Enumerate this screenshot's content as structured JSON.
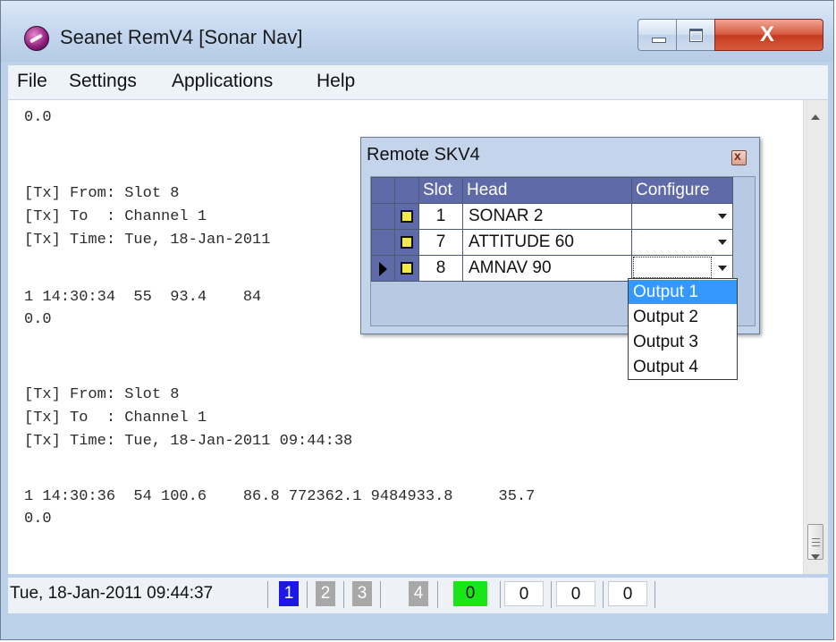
{
  "window": {
    "title": "Seanet RemV4 [Sonar Nav]",
    "minimize_label": "minimize",
    "maximize_label": "maximize",
    "close_label": "X"
  },
  "menu": {
    "items": [
      "File",
      "Settings",
      "Applications",
      "Help"
    ]
  },
  "console": {
    "lines": [
      "0.0",
      "[Tx] From: Slot 8",
      "[Tx] To  : Channel 1",
      "[Tx] Time: Tue, 18-Jan-2011",
      "1 14:30:34  55  93.4    84",
      "0.0",
      "[Tx] From: Slot 8",
      "[Tx] To  : Channel 1",
      "[Tx] Time: Tue, 18-Jan-2011 09:44:38",
      "1 14:30:36  54 100.6    86.8 772362.1 9484933.8     35.7",
      "0.0"
    ]
  },
  "dialog": {
    "title": "Remote SKV4",
    "close_glyph": "x",
    "columns": {
      "slot": "Slot",
      "head": "Head",
      "configure": "Configure"
    },
    "rows": [
      {
        "slot": "1",
        "head": "SONAR 2",
        "configure": ""
      },
      {
        "slot": "7",
        "head": "ATTITUDE 60",
        "configure": ""
      },
      {
        "slot": "8",
        "head": "AMNAV 90",
        "configure": ""
      }
    ],
    "dropdown_options": [
      "Output 1",
      "Output 2",
      "Output 3",
      "Output 4"
    ]
  },
  "status": {
    "timestamp": "Tue, 18-Jan-2011 09:44:37",
    "channels": [
      "1",
      "2",
      "3",
      "4",
      "0",
      "0",
      "0",
      "0"
    ],
    "colors": {
      "active_blue": "#1d18e6",
      "inactive_gray": "#a8a8a8",
      "green": "#19e619",
      "empty": "#ffffff"
    }
  }
}
